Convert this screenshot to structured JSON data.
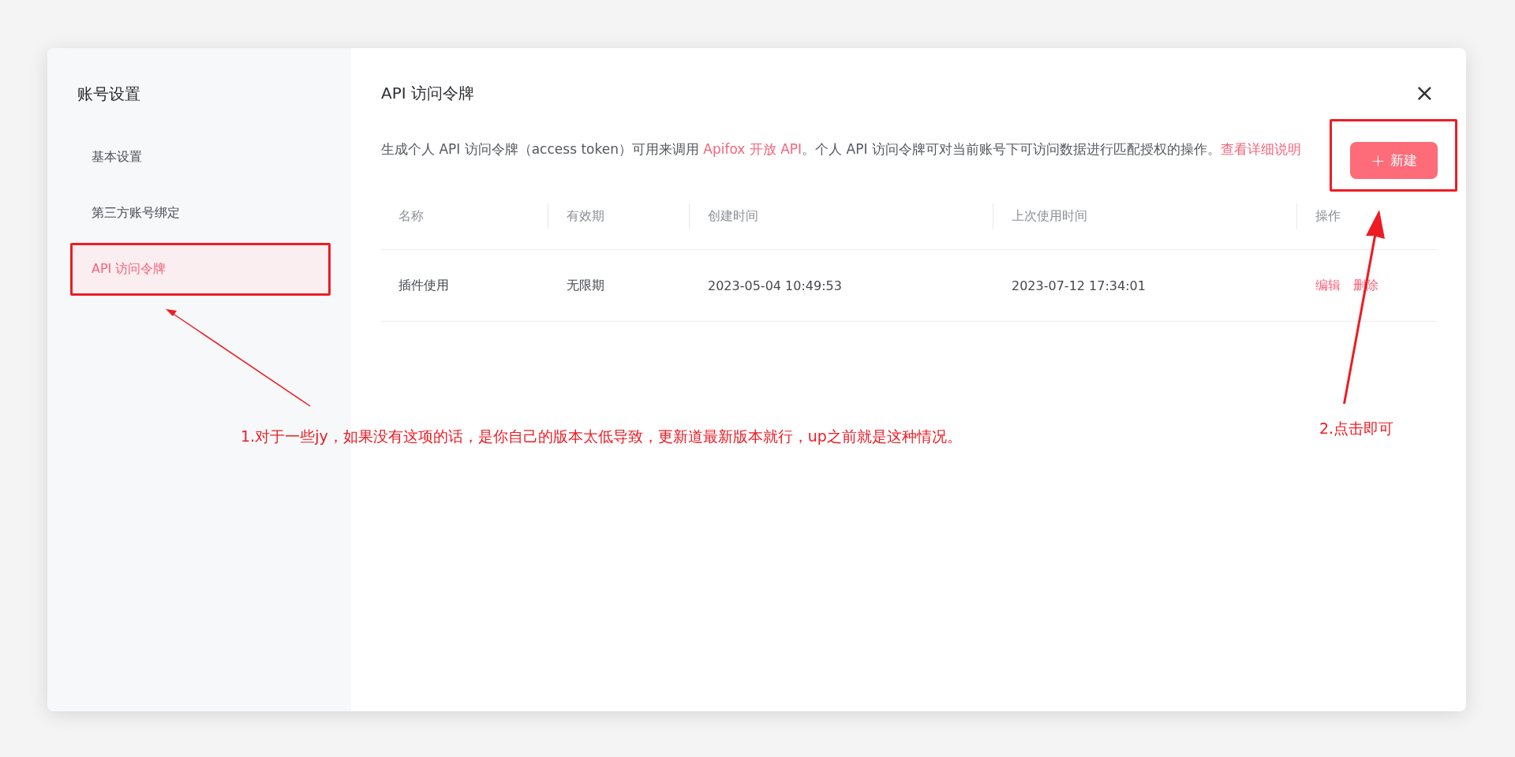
{
  "dialog": {
    "sidebar": {
      "title": "账号设置",
      "items": [
        {
          "label": "基本设置",
          "selected": false
        },
        {
          "label": "第三方账号绑定",
          "selected": false
        },
        {
          "label": "API 访问令牌",
          "selected": true
        }
      ]
    },
    "panel": {
      "title": "API 访问令牌",
      "close": "×",
      "description": [
        {
          "kind": "text",
          "text": "生成个人 API 访问令牌（access token）可用来调用 "
        },
        {
          "kind": "link",
          "text": "Apifox 开放 API"
        },
        {
          "kind": "text",
          "text": "。个人 API 访问令牌可对当前账号下可访问数据进行匹配授权的操作。"
        },
        {
          "kind": "link",
          "text": "查看详细说明"
        }
      ],
      "new_button": {
        "icon": "+",
        "label": "新建"
      },
      "table": {
        "columns": [
          "名称",
          "有效期",
          "创建时间",
          "上次使用时间",
          "操作"
        ],
        "rows": [
          {
            "cells": [
              "插件使用",
              "无限期",
              "2023-05-04 10:49:53",
              "2023-07-12 17:34:01"
            ],
            "actions": [
              "编辑",
              "删除"
            ]
          }
        ]
      }
    }
  },
  "annotations": {
    "note_1": "1.对于一些jy，如果没有这项的话，是你自己的版本太低导致，更新道最新版本就行，up之前就是这种情况。",
    "note_2": "2.点击即可"
  }
}
